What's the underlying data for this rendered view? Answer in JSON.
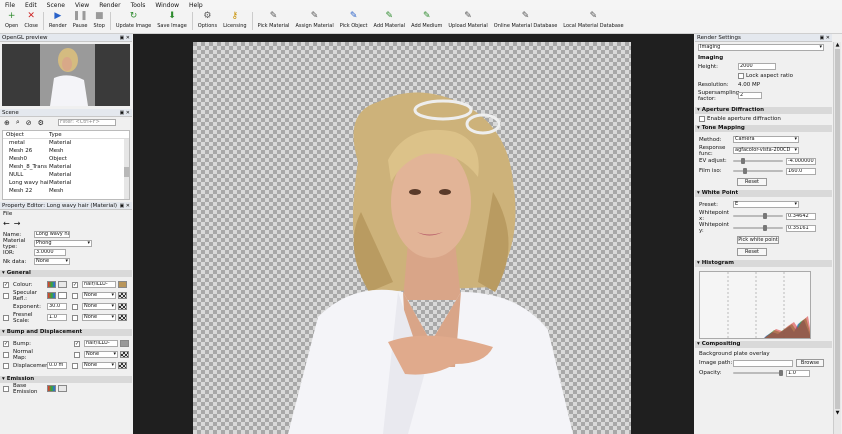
{
  "menu": [
    "File",
    "Edit",
    "Scene",
    "View",
    "Render",
    "Tools",
    "Window",
    "Help"
  ],
  "toolbar": [
    {
      "label": "Open",
      "icon": "plus-icon",
      "glyph": "+",
      "color": "#2e8b2e"
    },
    {
      "label": "Close",
      "icon": "close-icon",
      "glyph": "✕",
      "color": "#cc2222"
    },
    {
      "label": "Render",
      "icon": "play-icon",
      "glyph": "▶",
      "color": "#2a62c9"
    },
    {
      "label": "Pause",
      "icon": "pause-icon",
      "glyph": "❚❚",
      "color": "#9a9a9a"
    },
    {
      "label": "Stop",
      "icon": "stop-icon",
      "glyph": "■",
      "color": "#9a9a9a"
    },
    {
      "label": "Update Image",
      "icon": "refresh-icon",
      "glyph": "↻",
      "color": "#2e8b2e"
    },
    {
      "label": "Save Image",
      "icon": "save-image-icon",
      "glyph": "⬇",
      "color": "#2e8b2e"
    },
    {
      "label": "Options",
      "icon": "gear-icon",
      "glyph": "⚙",
      "color": "#555555"
    },
    {
      "label": "Licensing",
      "icon": "key-icon",
      "glyph": "⚷",
      "color": "#c89000"
    },
    {
      "label": "Pick Material",
      "icon": "pick-material-icon",
      "glyph": "✎",
      "color": "#555555"
    },
    {
      "label": "Assign Material",
      "icon": "assign-material-icon",
      "glyph": "✎",
      "color": "#555555"
    },
    {
      "label": "Pick Object",
      "icon": "pick-object-icon",
      "glyph": "✎",
      "color": "#2a62c9"
    },
    {
      "label": "Add Material",
      "icon": "add-material-icon",
      "glyph": "✎",
      "color": "#2e8b2e"
    },
    {
      "label": "Add Medium",
      "icon": "add-medium-icon",
      "glyph": "✎",
      "color": "#2e8b2e"
    },
    {
      "label": "Upload Material",
      "icon": "upload-icon",
      "glyph": "✎",
      "color": "#555555"
    },
    {
      "label": "Online Material Database",
      "icon": "database-icon",
      "glyph": "✎",
      "color": "#555555"
    },
    {
      "label": "Local Material Database",
      "icon": "database-icon",
      "glyph": "✎",
      "color": "#555555"
    }
  ],
  "opengl": {
    "title": "OpenGL preview"
  },
  "scene": {
    "title": "Scene",
    "filter_placeholder": "Filter: <Ctrl+F>",
    "headers": [
      "Object",
      "Type"
    ],
    "rows": [
      {
        "object": "metal",
        "type": "Material"
      },
      {
        "object": "Mesh 26",
        "type": "Mesh"
      },
      {
        "object": "Mesh0",
        "type": "Object"
      },
      {
        "object": "Mesh_8_Trans",
        "type": "Material"
      },
      {
        "object": "NULL",
        "type": "Material"
      },
      {
        "object": "Long wavy hair",
        "type": "Material"
      },
      {
        "object": "Mesh 22",
        "type": "Mesh"
      }
    ]
  },
  "property_editor": {
    "title": "Property Editor: Long wavy hair (Material)",
    "file_menu": "File",
    "name_label": "Name:",
    "name_value": "Long wavy hair",
    "material_type_label": "Material type:",
    "material_type_value": "Phong",
    "ior_label": "IOR:",
    "ior_value": "3.0000",
    "nk_label": "Nk data:",
    "nk_value": "None",
    "general_section": "General",
    "colour_label": "Colour:",
    "tex_value": "hair/ILLU-",
    "spec_label": "Specular Refl.:",
    "none_label": "None",
    "exponent_label": "Exponent:",
    "exponent_value": "30.0",
    "fresnel_label": "Fresnel Scale:",
    "fresnel_value": "1.0",
    "bump_section": "Bump and Displacement",
    "bump_label": "Bump:",
    "normal_label": "Normal Map:",
    "disp_label": "Displacement:",
    "disp_value": "0.0 m",
    "emission_section": "Emission",
    "base_emission_label": "Base Emission"
  },
  "render_settings": {
    "title": "Render Settings",
    "category": "Imaging",
    "imaging_header": "Imaging",
    "height_label": "Height:",
    "height_value": "2000",
    "lock_label": "Lock aspect ratio",
    "resolution_label": "Resolution:",
    "resolution_value": "4.00 MP",
    "downsampling_label": "Supersampling factor:",
    "downsampling_value": "2",
    "aperture_section": "Aperture Diffraction",
    "aperture_label": "Enable aperture diffraction",
    "tonemap_section": "Tone Mapping",
    "method_label": "Method:",
    "method_value": "Camera",
    "response_label": "Response func:",
    "response_value": "agfacolor-vista-200CD",
    "ev_label": "EV adjust:",
    "ev_value": "-4.000000",
    "film_label": "Film iso:",
    "film_value": "160.0",
    "reset_label": "Reset",
    "whitepoint_section": "White Point",
    "preset_label": "Preset:",
    "preset_value": "E",
    "wpx_label": "Whitepoint x:",
    "wpx_value": "0.34642",
    "wpy_label": "Whitepoint y:",
    "wpy_value": "0.35161",
    "pick_white_label": "Pick white point",
    "histogram_section": "Histogram",
    "compositing_section": "Compositing",
    "bg_overlay_label": "Background plate overlay",
    "image_path_label": "Image path:",
    "browse_label": "Browse",
    "opacity_label": "Opacity:",
    "opacity_value": "1.0"
  },
  "colors": {
    "viewport_bg": "#1f1f1f",
    "checker_light": "#d9d9d9",
    "checker_dark": "#a8a8a8",
    "section_bg": "#d9d9d9",
    "panel_title_bg": "#e4e8ee"
  }
}
